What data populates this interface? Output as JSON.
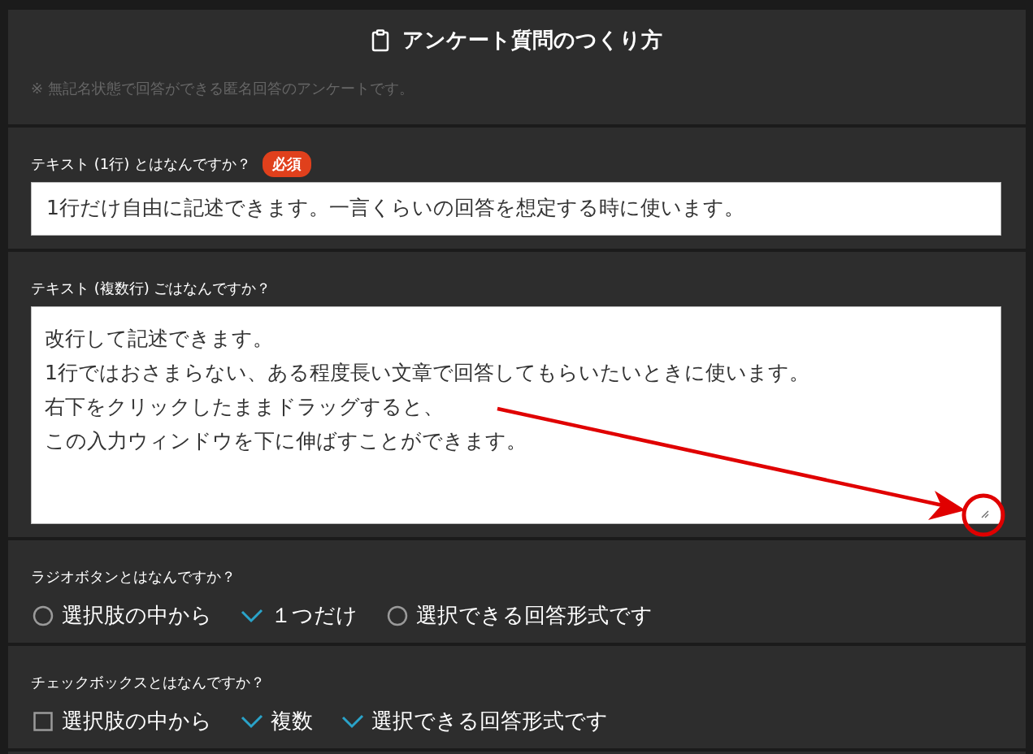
{
  "header": {
    "title": "アンケート質問のつくり方",
    "note": "※ 無記名状態で回答ができる匿名回答のアンケートです。"
  },
  "questions": [
    {
      "kind": "text",
      "label": "テキスト (1行) とはなんですか？",
      "badge": "必須",
      "value": "1行だけ自由に記述できます。一言くらいの回答を想定する時に使います。"
    },
    {
      "kind": "textarea",
      "label": "テキスト (複数行) ごはなんですか？",
      "lines": [
        "改行して記述できます。",
        "1行ではおさまらない、ある程度長い文章で回答してもらいたいときに使います。",
        "右下をクリックしたままドラッグすると、",
        "この入力ウィンドウを下に伸ばすことができます。"
      ]
    },
    {
      "kind": "radio",
      "label": "ラジオボタンとはなんですか？",
      "options": [
        {
          "label": "選択肢の中から",
          "selected": false
        },
        {
          "label": "１つだけ",
          "selected": true
        },
        {
          "label": "選択できる回答形式です",
          "selected": false
        }
      ]
    },
    {
      "kind": "checkbox",
      "label": "チェックボックスとはなんですか？",
      "options": [
        {
          "label": "選択肢の中から",
          "selected": false
        },
        {
          "label": "複数",
          "selected": true
        },
        {
          "label": "選択できる回答形式です",
          "selected": true
        }
      ]
    }
  ],
  "annotations": {
    "arrow": true,
    "circle": true
  }
}
